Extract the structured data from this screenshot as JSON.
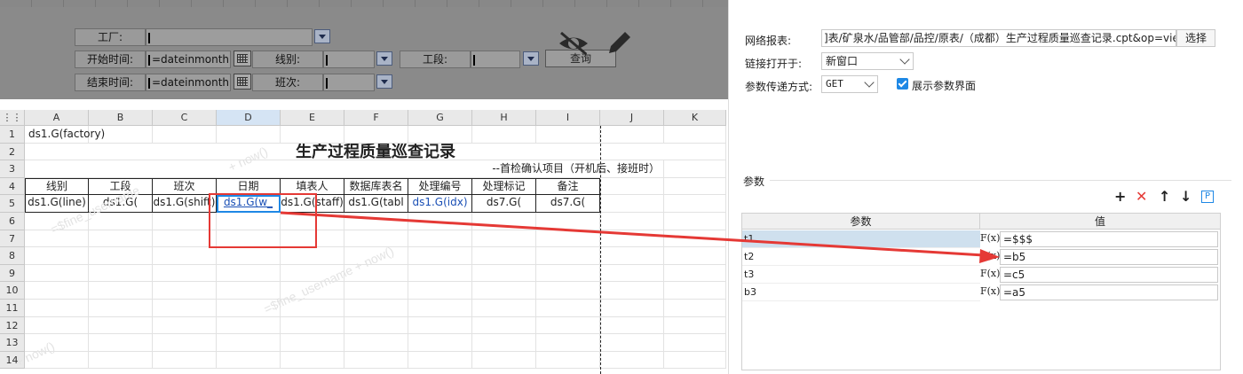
{
  "param_panel": {
    "factory_label": "工厂:",
    "start_label": "开始时间:",
    "start_value": "=dateinmonth(to",
    "end_label": "结束时间:",
    "end_value": "=dateinmonth(to",
    "line_label": "线别:",
    "shift_label": "班次:",
    "section_label": "工段:",
    "query_button": "查询"
  },
  "sheet": {
    "columns": [
      "A",
      "B",
      "C",
      "D",
      "E",
      "F",
      "G",
      "H",
      "I",
      "J",
      "K"
    ],
    "rows": [
      "1",
      "2",
      "3",
      "4",
      "5",
      "6",
      "7",
      "8",
      "9",
      "10",
      "11",
      "12",
      "13",
      "14"
    ],
    "r1_a": "ds1.G(factory)",
    "title": "生产过程质量巡查记录",
    "subtitle": "--首检确认项目（开机后、接班时）",
    "headers": [
      "线别",
      "工段",
      "班次",
      "日期",
      "填表人",
      "数据库表名",
      "处理编号",
      "处理标记",
      "备注"
    ],
    "row5": [
      "ds1.G(line)",
      "ds1.G(",
      "ds1.G(shift)",
      "ds1.G(w_",
      "ds1.G(staff)",
      "ds1.G(tabl",
      "ds1.G(idx)",
      "ds7.G(",
      "ds7.G("
    ],
    "watermarks": [
      "=$fine_username",
      "+ now()",
      "=$fine_username + now()"
    ]
  },
  "right_panel": {
    "report_label": "网络报表:",
    "report_value": "]表/矿泉水/品管部/品控/原表/（成都）生产过程质量巡查记录.cpt&op=view",
    "choose_button": "选择",
    "open_label": "链接打开于:",
    "open_value": "新窗口",
    "method_label": "参数传递方式:",
    "method_value": "GET",
    "show_params_label": "展示参数界面",
    "params_section": "参数",
    "param_col": "参数",
    "value_col": "值",
    "params": [
      {
        "name": "t1",
        "value": "=$$$"
      },
      {
        "name": "t2",
        "value": "=b5"
      },
      {
        "name": "t3",
        "value": "=c5"
      },
      {
        "name": "b3",
        "value": "=a5"
      }
    ],
    "fx_label": "F(x)",
    "toolbar_p": "P"
  },
  "colors": {
    "accent": "#1e88e5",
    "highlight": "#e53935"
  }
}
